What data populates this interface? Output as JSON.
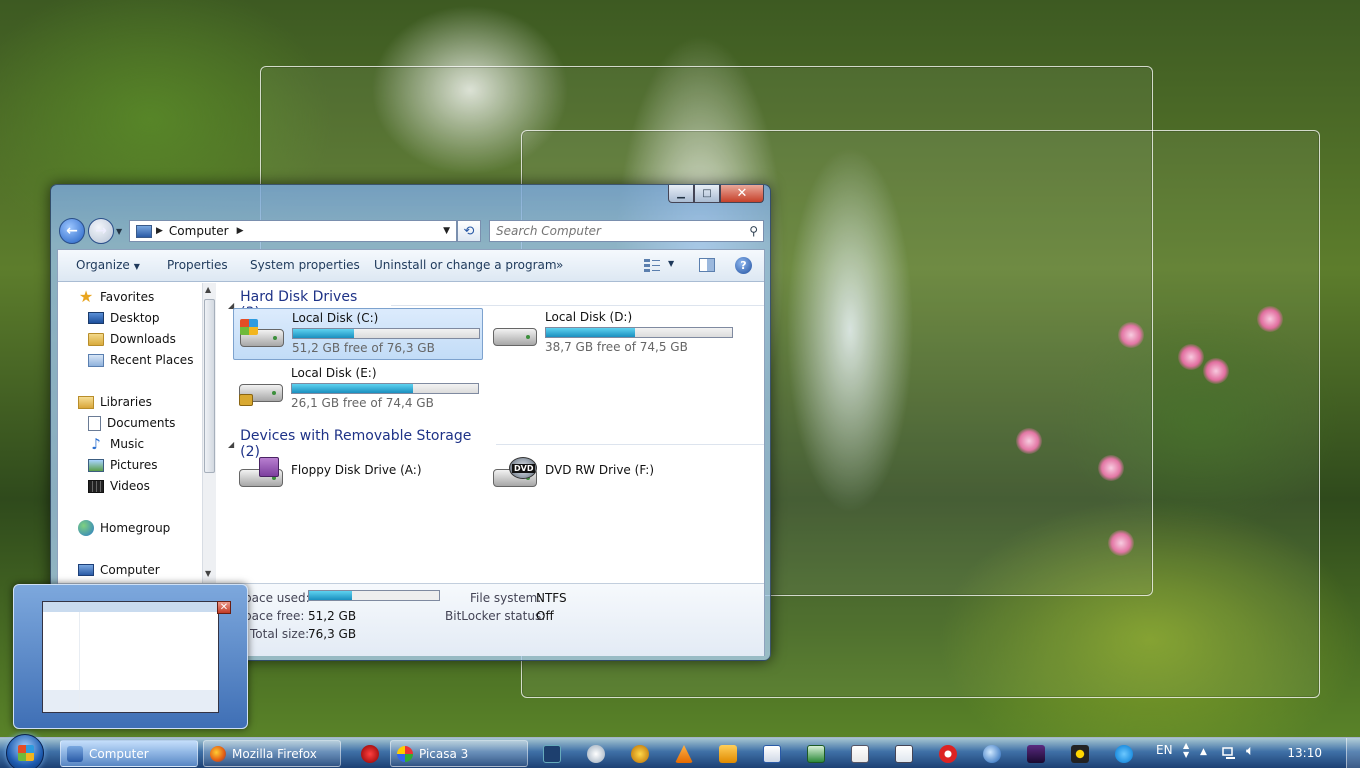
{
  "window": {
    "address": {
      "crumb": "Computer"
    },
    "search": {
      "placeholder": "Search Computer"
    },
    "toolbar": {
      "organize": "Organize",
      "properties": "Properties",
      "system_properties": "System properties",
      "uninstall": "Uninstall or change a program",
      "more": "»"
    },
    "nav": {
      "favorites": "Favorites",
      "desktop": "Desktop",
      "downloads": "Downloads",
      "recent_places": "Recent Places",
      "libraries": "Libraries",
      "documents": "Documents",
      "music": "Music",
      "pictures": "Pictures",
      "videos": "Videos",
      "homegroup": "Homegroup",
      "computer": "Computer"
    },
    "groups": {
      "hard_disks": "Hard Disk Drives (3)",
      "removable": "Devices with Removable Storage (2)"
    },
    "drives": [
      {
        "name": "Local Disk (C:)",
        "free": "51,2 GB free of 76,3 GB",
        "used_fraction": 0.33
      },
      {
        "name": "Local Disk (D:)",
        "free": "38,7 GB free of 74,5 GB",
        "used_fraction": 0.48
      },
      {
        "name": "Local Disk (E:)",
        "free": "26,1 GB free of 74,4 GB",
        "used_fraction": 0.65
      }
    ],
    "removable": [
      {
        "name": "Floppy Disk Drive (A:)"
      },
      {
        "name": "DVD RW Drive (F:)"
      }
    ],
    "details": {
      "space_used_label": "pace used:",
      "space_free_label": "pace free:",
      "space_free_value": "51,2 GB",
      "total_size_label": "Total size:",
      "total_size_value": "76,3 GB",
      "file_system_label": "File system:",
      "file_system_value": "NTFS",
      "bitlocker_label": "BitLocker status:",
      "bitlocker_value": "Off",
      "used_fraction": 0.33
    }
  },
  "taskbar": {
    "items": [
      {
        "label": "Computer"
      },
      {
        "label": "Mozilla Firefox"
      },
      {
        "label": "Picasa 3"
      }
    ],
    "language": "EN",
    "clock": "13:10"
  },
  "colors": {
    "accent": "#1e3287",
    "progress": "#1a8fbf"
  }
}
